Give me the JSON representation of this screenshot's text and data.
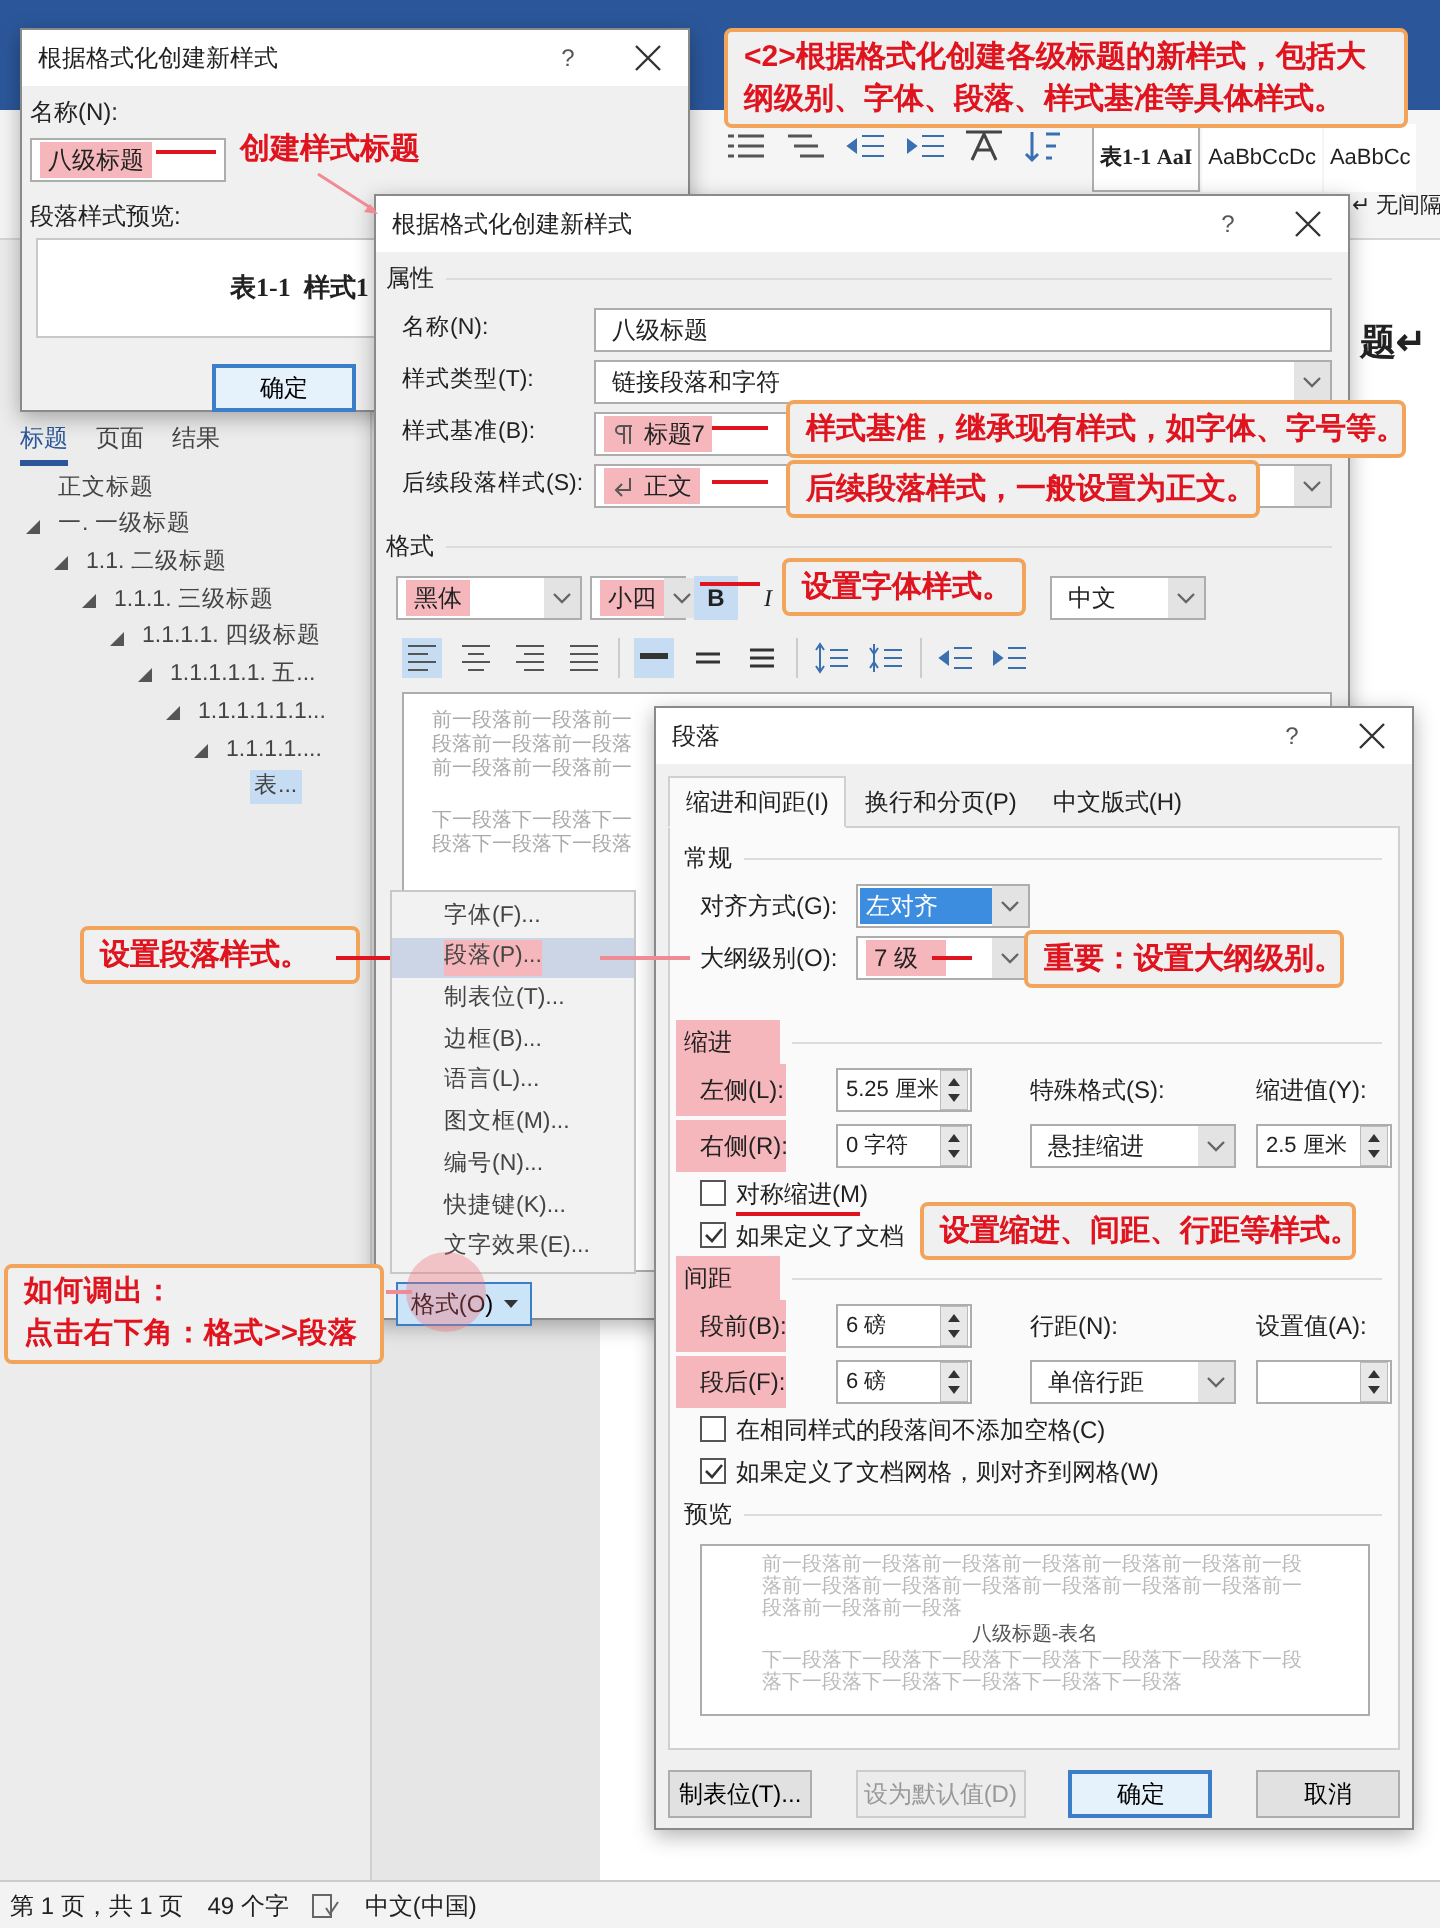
{
  "word_window": {
    "ribbon": {
      "style_gallery": [
        {
          "label": "表1-1 AaI",
          "selected": true
        },
        {
          "label": "AaBbCcDc",
          "selected": false
        },
        {
          "label": "AaBbCc",
          "selected": false
        }
      ],
      "style_caption": "↵ 无间隔"
    },
    "navigation_pane": {
      "tabs": [
        {
          "label": "标题",
          "selected": true
        },
        {
          "label": "页面",
          "selected": false
        },
        {
          "label": "结果",
          "selected": false
        }
      ],
      "headings": [
        {
          "label": "正文标题",
          "selected": false
        },
        {
          "label": "一. 一级标题",
          "selected": false,
          "expanded": true,
          "children": [
            {
              "label": "1.1. 二级标题",
              "selected": false,
              "expanded": true,
              "children": [
                {
                  "label": "1.1.1. 三级标题",
                  "selected": false,
                  "expanded": true,
                  "children": [
                    {
                      "label": "1.1.1.1. 四级标题",
                      "selected": false,
                      "expanded": true,
                      "children": [
                        {
                          "label": "1.1.1.1.1. 五...",
                          "selected": false,
                          "expanded": true,
                          "children": [
                            {
                              "label": "1.1.1.1.1.1...",
                              "selected": false,
                              "expanded": true,
                              "children": [
                                {
                                  "label": "1.1.1.1....",
                                  "selected": false,
                                  "expanded": true,
                                  "children": [
                                    {
                                      "label": "表...",
                                      "selected": true
                                    }
                                  ]
                                }
                              ]
                            }
                          ]
                        }
                      ]
                    }
                  ]
                }
              ]
            }
          ]
        }
      ]
    },
    "document_text": "题↵",
    "status_bar": [
      "第 1 页，共 1 页",
      "49 个字",
      "中文(中国)"
    ]
  },
  "dialog_quick": {
    "title": "根据格式化创建新样式",
    "help": "?",
    "name_label": "名称(N):",
    "name_value": "八级标题",
    "name_highlighted": true,
    "preview_label": "段落样式预览:",
    "preview_text": "表1-1  样式1",
    "ok": "确定"
  },
  "dialog_new_style": {
    "title": "根据格式化创建新样式",
    "help": "?",
    "section_properties": "属性",
    "properties": [
      {
        "label": "名称(N):",
        "value": "八级标题",
        "kind": "text",
        "highlighted": false
      },
      {
        "label": "样式类型(T):",
        "value": "链接段落和字符",
        "kind": "select",
        "highlighted": false
      },
      {
        "label": "样式基准(B):",
        "value": "标题7",
        "kind": "style-select",
        "highlighted": true
      },
      {
        "label": "后续段落样式(S):",
        "value": "正文",
        "kind": "return-select",
        "highlighted": true
      }
    ],
    "section_format": "格式",
    "font": {
      "value": "黑体",
      "highlighted": true
    },
    "size": {
      "value": "小四",
      "highlighted": true
    },
    "bold": {
      "label": "B",
      "on": true
    },
    "italic": {
      "label": "I",
      "on": false
    },
    "script": "中文",
    "align_buttons": [
      {
        "kind": "left",
        "selected": true
      },
      {
        "kind": "center",
        "selected": false
      },
      {
        "kind": "right",
        "selected": false
      },
      {
        "kind": "justify",
        "selected": false
      }
    ],
    "spacing_buttons": [
      {
        "kind": "single",
        "selected": true
      },
      {
        "kind": "onehalf",
        "selected": false
      },
      {
        "kind": "double",
        "selected": false
      }
    ],
    "preview_before": [
      "前一段落前一段落前一",
      "段落前一段落前一段落",
      "前一段落前一段落前一"
    ],
    "preview_after": [
      "下一段落下一段落下一",
      "段落下一段落下一段落"
    ],
    "format_button": "格式(O)"
  },
  "format_menu": [
    {
      "label": "字体(F)...",
      "selected": false,
      "highlighted": false
    },
    {
      "label": "段落(P)...",
      "selected": true,
      "highlighted": true
    },
    {
      "label": "制表位(T)...",
      "selected": false,
      "highlighted": false
    },
    {
      "label": "边框(B)...",
      "selected": false,
      "highlighted": false
    },
    {
      "label": "语言(L)...",
      "selected": false,
      "highlighted": false
    },
    {
      "label": "图文框(M)...",
      "selected": false,
      "highlighted": false
    },
    {
      "label": "编号(N)...",
      "selected": false,
      "highlighted": false
    },
    {
      "label": "快捷键(K)...",
      "selected": false,
      "highlighted": false
    },
    {
      "label": "文字效果(E)...",
      "selected": false,
      "highlighted": false
    }
  ],
  "dialog_paragraph": {
    "title": "段落",
    "help": "?",
    "tabs": [
      {
        "label": "缩进和间距(I)",
        "selected": true
      },
      {
        "label": "换行和分页(P)",
        "selected": false
      },
      {
        "label": "中文版式(H)",
        "selected": false
      }
    ],
    "general": {
      "title": "常规",
      "alignment": {
        "label": "对齐方式(G):",
        "value": "左对齐",
        "focused": true
      },
      "outline": {
        "label": "大纲级别(O):",
        "value": "7 级",
        "highlighted": true
      }
    },
    "indent": {
      "title": "缩进",
      "highlighted": true,
      "left": {
        "label": "左侧(L):",
        "value": "5.25 厘米"
      },
      "right": {
        "label": "右侧(R):",
        "value": "0 字符"
      },
      "special": {
        "label": "特殊格式(S):",
        "value": "悬挂缩进"
      },
      "by": {
        "label": "缩进值(Y):",
        "value": "2.5 厘米"
      },
      "checks": [
        {
          "label": "对称缩进(M)",
          "checked": false
        },
        {
          "label": "如果定义了文档",
          "checked": true
        }
      ]
    },
    "spacing": {
      "title": "间距",
      "highlighted": true,
      "before": {
        "label": "段前(B):",
        "value": "6 磅"
      },
      "after": {
        "label": "段后(F):",
        "value": "6 磅"
      },
      "line": {
        "label": "行距(N):",
        "value": "单倍行距"
      },
      "at": {
        "label": "设置值(A):"
      },
      "checks": [
        {
          "label": "在相同样式的段落间不添加空格(C)",
          "checked": false
        },
        {
          "label": "如果定义了文档网格，则对齐到网格(W)",
          "checked": true
        }
      ]
    },
    "preview": {
      "title": "预览",
      "before": "前一段落前一段落前一段落前一段落前一段落前一段落前一段落前一段落前一段落前一段落前一段落前一段落前一段落前一段落前一段落前一段落",
      "sample": "八级标题-表名",
      "after": "下一段落下一段落下一段落下一段落下一段落下一段落下一段落下一段落下一段落下一段落下一段落下一段落"
    },
    "buttons": [
      {
        "label": "制表位(T)...",
        "kind": "normal"
      },
      {
        "label": "设为默认值(D)",
        "kind": "disabled"
      },
      {
        "label": "确定",
        "kind": "default"
      },
      {
        "label": "取消",
        "kind": "normal"
      }
    ]
  },
  "annotations": [
    {
      "kind": "callout",
      "lines": [
        "<2>根据格式化创建各级标题的新样式，包括大纲级别、字体、段落、样式基准等具体样式。"
      ]
    },
    {
      "kind": "plain",
      "lines": [
        "创建样式标题"
      ]
    },
    {
      "kind": "callout",
      "lines": [
        "样式基准，继承现有样式，如字体、字号等。"
      ]
    },
    {
      "kind": "callout",
      "lines": [
        "后续段落样式，一般设置为正文。"
      ]
    },
    {
      "kind": "callout",
      "lines": [
        "设置字体样式。"
      ]
    },
    {
      "kind": "callout",
      "lines": [
        "设置段落样式。"
      ]
    },
    {
      "kind": "callout",
      "lines": [
        "重要：设置大纲级别。"
      ]
    },
    {
      "kind": "callout",
      "lines": [
        "设置缩进、间距、行距等样式。"
      ]
    },
    {
      "kind": "callout",
      "lines": [
        "如何调出：",
        "点击右下角：格式>>段落"
      ]
    }
  ]
}
